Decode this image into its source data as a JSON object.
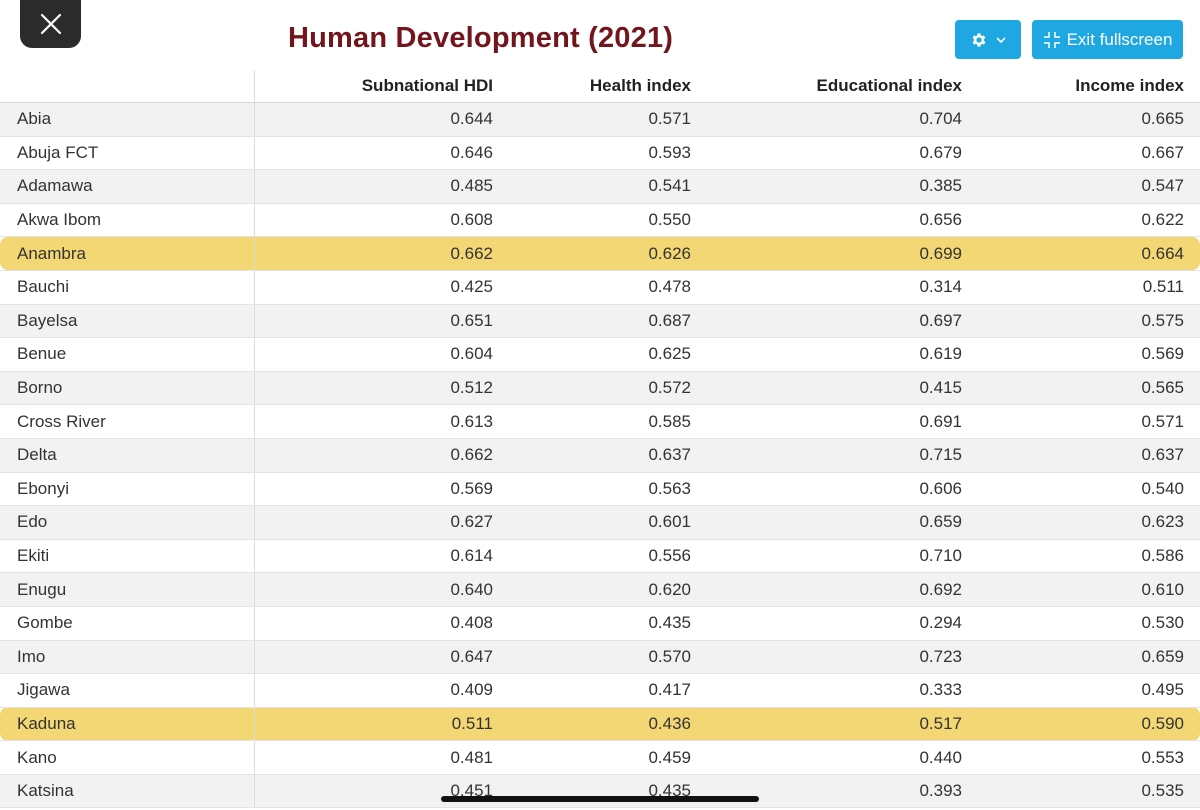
{
  "header": {
    "title": "Human Development (2021)",
    "exit_label": "Exit fullscreen"
  },
  "icons": {
    "close": "close-icon",
    "settings": "gear-icon",
    "settings_caret": "chevron-down-icon",
    "exit": "exit-fullscreen-icon"
  },
  "colors": {
    "title": "#73151c",
    "accent_button": "#1ea7e1",
    "highlight": "#f3d774"
  },
  "table": {
    "columns": [
      "",
      "Subnational HDI",
      "Health index",
      "Educational index",
      "Income index"
    ],
    "rows": [
      {
        "name": "Abia",
        "hdi": "0.644",
        "health": "0.571",
        "edu": "0.704",
        "income": "0.665",
        "highlighted": false
      },
      {
        "name": "Abuja FCT",
        "hdi": "0.646",
        "health": "0.593",
        "edu": "0.679",
        "income": "0.667",
        "highlighted": false
      },
      {
        "name": "Adamawa",
        "hdi": "0.485",
        "health": "0.541",
        "edu": "0.385",
        "income": "0.547",
        "highlighted": false
      },
      {
        "name": "Akwa Ibom",
        "hdi": "0.608",
        "health": "0.550",
        "edu": "0.656",
        "income": "0.622",
        "highlighted": false
      },
      {
        "name": "Anambra",
        "hdi": "0.662",
        "health": "0.626",
        "edu": "0.699",
        "income": "0.664",
        "highlighted": true
      },
      {
        "name": "Bauchi",
        "hdi": "0.425",
        "health": "0.478",
        "edu": "0.314",
        "income": "0.511",
        "highlighted": false
      },
      {
        "name": "Bayelsa",
        "hdi": "0.651",
        "health": "0.687",
        "edu": "0.697",
        "income": "0.575",
        "highlighted": false
      },
      {
        "name": "Benue",
        "hdi": "0.604",
        "health": "0.625",
        "edu": "0.619",
        "income": "0.569",
        "highlighted": false
      },
      {
        "name": "Borno",
        "hdi": "0.512",
        "health": "0.572",
        "edu": "0.415",
        "income": "0.565",
        "highlighted": false
      },
      {
        "name": "Cross River",
        "hdi": "0.613",
        "health": "0.585",
        "edu": "0.691",
        "income": "0.571",
        "highlighted": false
      },
      {
        "name": "Delta",
        "hdi": "0.662",
        "health": "0.637",
        "edu": "0.715",
        "income": "0.637",
        "highlighted": false
      },
      {
        "name": "Ebonyi",
        "hdi": "0.569",
        "health": "0.563",
        "edu": "0.606",
        "income": "0.540",
        "highlighted": false
      },
      {
        "name": "Edo",
        "hdi": "0.627",
        "health": "0.601",
        "edu": "0.659",
        "income": "0.623",
        "highlighted": false
      },
      {
        "name": "Ekiti",
        "hdi": "0.614",
        "health": "0.556",
        "edu": "0.710",
        "income": "0.586",
        "highlighted": false
      },
      {
        "name": "Enugu",
        "hdi": "0.640",
        "health": "0.620",
        "edu": "0.692",
        "income": "0.610",
        "highlighted": false
      },
      {
        "name": "Gombe",
        "hdi": "0.408",
        "health": "0.435",
        "edu": "0.294",
        "income": "0.530",
        "highlighted": false
      },
      {
        "name": "Imo",
        "hdi": "0.647",
        "health": "0.570",
        "edu": "0.723",
        "income": "0.659",
        "highlighted": false
      },
      {
        "name": "Jigawa",
        "hdi": "0.409",
        "health": "0.417",
        "edu": "0.333",
        "income": "0.495",
        "highlighted": false
      },
      {
        "name": "Kaduna",
        "hdi": "0.511",
        "health": "0.436",
        "edu": "0.517",
        "income": "0.590",
        "highlighted": true
      },
      {
        "name": "Kano",
        "hdi": "0.481",
        "health": "0.459",
        "edu": "0.440",
        "income": "0.553",
        "highlighted": false
      },
      {
        "name": "Katsina",
        "hdi": "0.451",
        "health": "0.435",
        "edu": "0.393",
        "income": "0.535",
        "highlighted": false
      }
    ]
  }
}
